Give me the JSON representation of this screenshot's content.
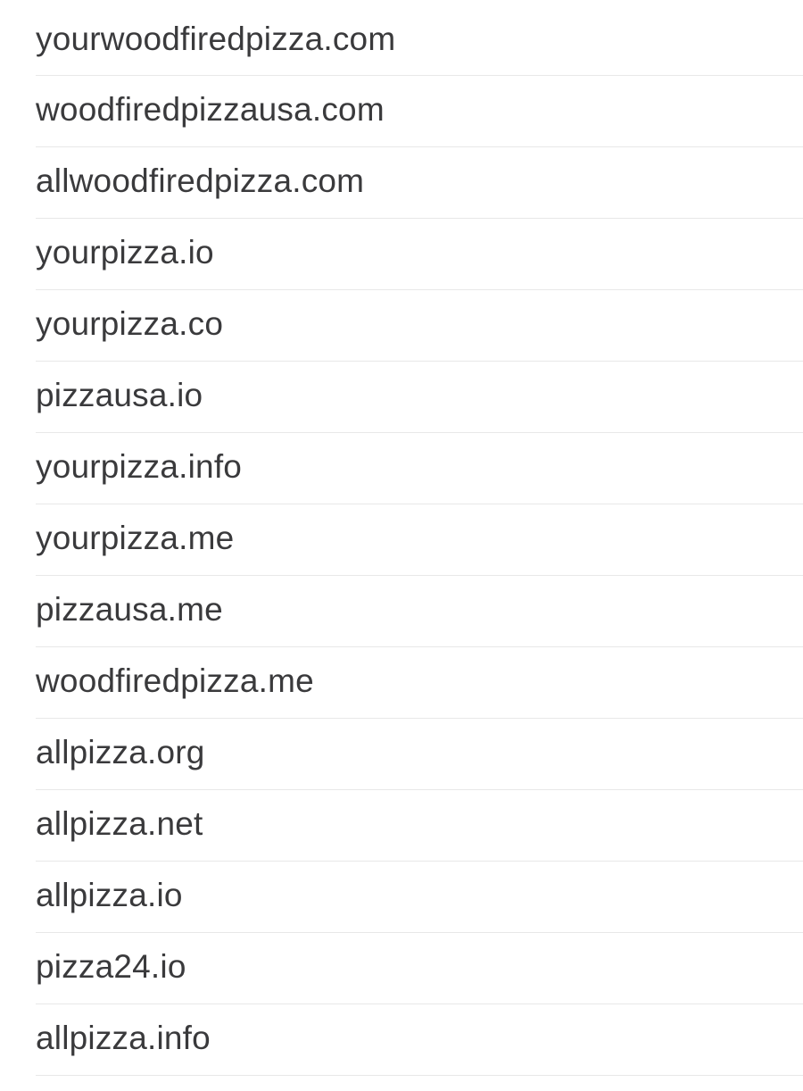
{
  "domains": [
    {
      "name": "yourwoodfiredpizza.com"
    },
    {
      "name": "woodfiredpizzausa.com"
    },
    {
      "name": "allwoodfiredpizza.com"
    },
    {
      "name": "yourpizza.io"
    },
    {
      "name": "yourpizza.co"
    },
    {
      "name": "pizzausa.io"
    },
    {
      "name": "yourpizza.info"
    },
    {
      "name": "yourpizza.me"
    },
    {
      "name": "pizzausa.me"
    },
    {
      "name": "woodfiredpizza.me"
    },
    {
      "name": "allpizza.org"
    },
    {
      "name": "allpizza.net"
    },
    {
      "name": "allpizza.io"
    },
    {
      "name": "pizza24.io"
    },
    {
      "name": "allpizza.info"
    }
  ]
}
